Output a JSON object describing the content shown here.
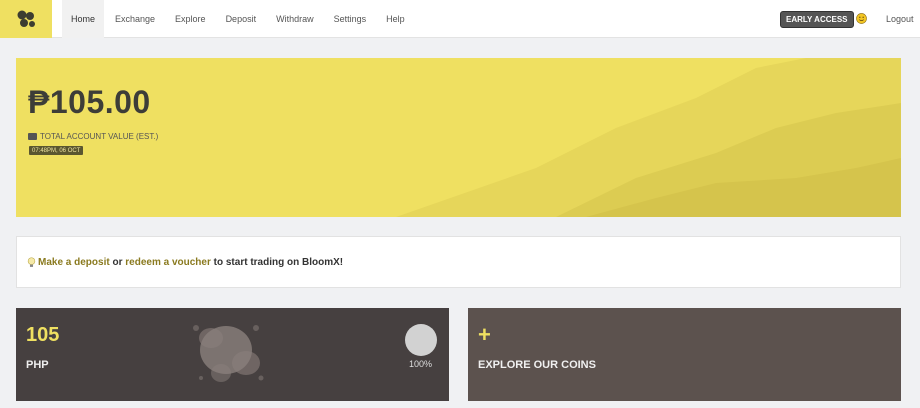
{
  "nav": {
    "items": [
      {
        "label": "Home",
        "active": true
      },
      {
        "label": "Exchange",
        "active": false
      },
      {
        "label": "Explore",
        "active": false
      },
      {
        "label": "Deposit",
        "active": false
      },
      {
        "label": "Withdraw",
        "active": false
      },
      {
        "label": "Settings",
        "active": false
      },
      {
        "label": "Help",
        "active": false
      }
    ],
    "badge": "EARLY ACCESS",
    "logout": "Logout"
  },
  "hero": {
    "balance": "₱105.00",
    "label": "TOTAL ACCOUNT VALUE (EST.)",
    "timestamp": "07:48PM, 06 OCT"
  },
  "info": {
    "link1": "Make a deposit",
    "or": " or ",
    "link2": "redeem a voucher",
    "rest": " to start trading on BloomX!"
  },
  "cards": {
    "php": {
      "amount": "105",
      "currency": "PHP",
      "percent": "100%"
    },
    "explore": {
      "plus": "+",
      "label": "EXPLORE OUR COINS"
    }
  },
  "colors": {
    "accent": "#efe061",
    "dark_card": "#464040",
    "explore_card": "#5c524e",
    "link": "#8a7a1f"
  },
  "icons": {
    "logo": "bloomx-logo-icon",
    "user": "smiley-icon",
    "wallet": "wallet-icon",
    "bulb": "lightbulb-icon"
  }
}
